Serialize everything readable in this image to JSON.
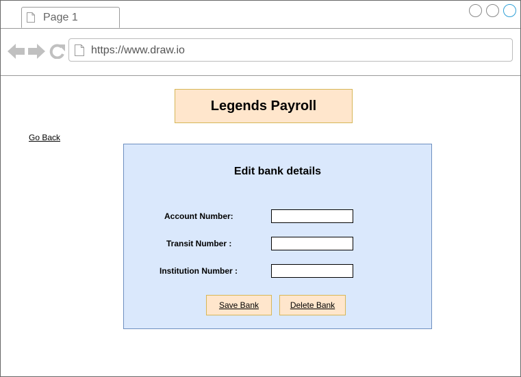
{
  "browser": {
    "tab_label": "Page 1",
    "url": "https://www.draw.io"
  },
  "icons": {
    "tab": "page-icon",
    "back": "arrow-left-icon",
    "forward": "arrow-right-icon",
    "reload": "reload-icon",
    "address": "page-icon"
  },
  "colors": {
    "header_fill": "#ffe6cc",
    "header_border": "#d6b656",
    "panel_fill": "#dae8fc",
    "panel_border": "#6c8ebf",
    "active_control": "#2d9fd6"
  },
  "app": {
    "title": "Legends Payroll",
    "go_back": "Go Back"
  },
  "form": {
    "title": "Edit bank details",
    "account_label": "Account Number:",
    "account_value": "",
    "transit_label": "Transit Number :",
    "transit_value": "",
    "institution_label": "Institution Number :",
    "institution_value": "",
    "save_label": "Save Bank",
    "delete_label": "Delete Bank"
  }
}
